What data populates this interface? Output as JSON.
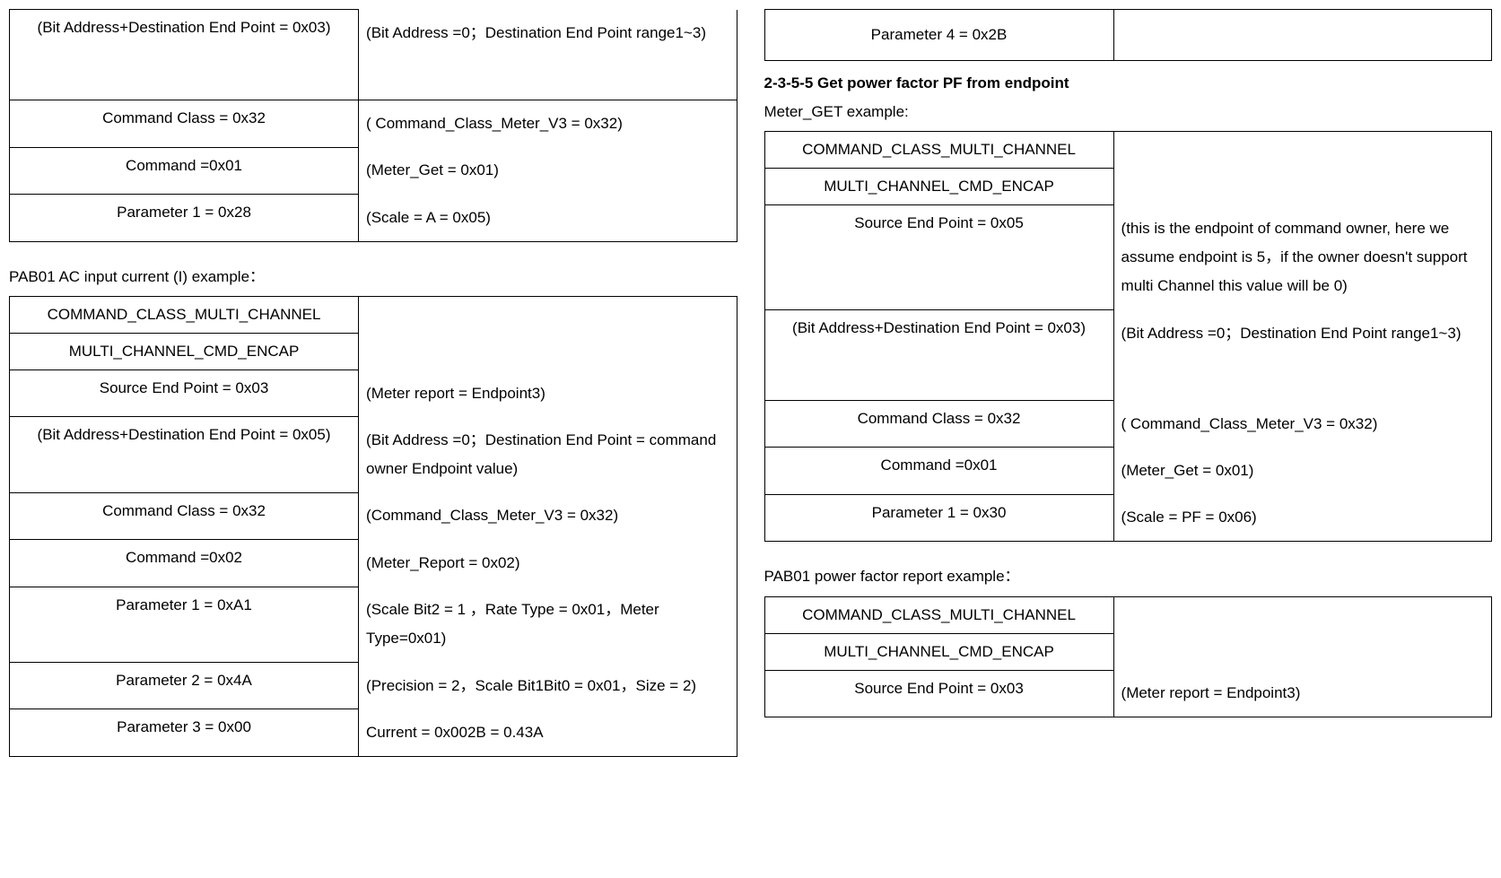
{
  "left": {
    "table1": {
      "r1c1": "(Bit Address+Destination End Point = 0x03)",
      "r1c2": "(Bit Address =0；Destination End Point range1~3)",
      "r2c1": "Command Class = 0x32",
      "r2c2": "( Command_Class_Meter_V3 = 0x32)",
      "r3c1": "Command =0x01",
      "r3c2": "(Meter_Get = 0x01)",
      "r4c1": "Parameter 1 = 0x28",
      "r4c2": "(Scale = A = 0x05)"
    },
    "caption1": "PAB01 AC input current (I) example：",
    "table2": {
      "r1c1": "COMMAND_CLASS_MULTI_CHANNEL",
      "r1c2": "",
      "r2c1": "MULTI_CHANNEL_CMD_ENCAP",
      "r2c2": "",
      "r3c1": "Source End Point = 0x03",
      "r3c2": "(Meter report = Endpoint3)",
      "r4c1": "(Bit Address+Destination End Point = 0x05)",
      "r4c2": "(Bit Address =0；Destination End Point = command owner Endpoint value)",
      "r5c1": "Command Class = 0x32",
      "r5c2": "(Command_Class_Meter_V3 = 0x32)",
      "r6c1": "Command =0x02",
      "r6c2": "(Meter_Report = 0x02)",
      "r7c1": "Parameter 1 = 0xA1",
      "r7c2": "(Scale Bit2 = 1 ，Rate Type = 0x01，Meter Type=0x01)",
      "r8c1": "Parameter 2 = 0x4A",
      "r8c2": "(Precision = 2，Scale Bit1Bit0 = 0x01，Size = 2)",
      "r9c1": "Parameter 3 = 0x00",
      "r9c2": "Current = 0x002B = 0.43A"
    }
  },
  "right": {
    "table0": {
      "r1c1": "Parameter 4 = 0x2B",
      "r1c2": ""
    },
    "heading": "2-3-5-5 Get power factor PF from endpoint",
    "caption1": "Meter_GET example:",
    "table1": {
      "r1c1": "COMMAND_CLASS_MULTI_CHANNEL",
      "r1c2": "",
      "r2c1": "MULTI_CHANNEL_CMD_ENCAP",
      "r2c2": "",
      "r3c1": "Source End Point = 0x05",
      "r3c2": "(this is the endpoint of command owner, here we assume endpoint is 5，if the owner doesn't support multi Channel this value will be 0)",
      "r4c1": "(Bit Address+Destination End Point = 0x03)",
      "r4c2": "(Bit Address =0；Destination End Point range1~3)",
      "r5c1": "Command Class = 0x32",
      "r5c2": "( Command_Class_Meter_V3 = 0x32)",
      "r6c1": "Command =0x01",
      "r6c2": "(Meter_Get = 0x01)",
      "r7c1": "Parameter 1 = 0x30",
      "r7c2": "(Scale = PF = 0x06)"
    },
    "caption2": "PAB01 power factor report example：",
    "table2": {
      "r1c1": "COMMAND_CLASS_MULTI_CHANNEL",
      "r1c2": "",
      "r2c1": "MULTI_CHANNEL_CMD_ENCAP",
      "r2c2": "",
      "r3c1": "Source End Point = 0x03",
      "r3c2": "(Meter report = Endpoint3)"
    }
  }
}
